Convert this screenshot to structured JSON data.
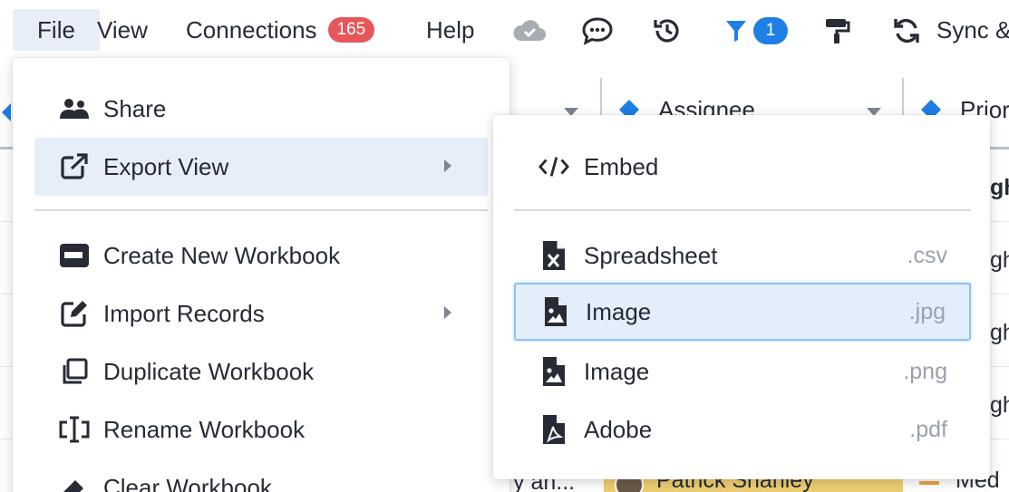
{
  "menubar": {
    "file": "File",
    "view": "View",
    "connections": "Connections",
    "connections_count": "165",
    "help": "Help",
    "filter_count": "1",
    "sync": "Sync &"
  },
  "grid": {
    "col_assignee": "Assignee",
    "col_priority": "Priori",
    "cell_truncated": "y an...",
    "cell_assignee": "Patrick Shanley",
    "cell_priority": "Med",
    "right_cells": [
      "gh",
      "gh",
      "gh",
      "gh",
      "gh"
    ]
  },
  "file_menu": {
    "items": [
      {
        "label": "Share",
        "icon": "users-icon"
      },
      {
        "label": "Export View",
        "icon": "external-link-icon"
      },
      {
        "label": "Create New Workbook",
        "icon": "id-card-icon"
      },
      {
        "label": "Import Records",
        "icon": "edit-icon"
      },
      {
        "label": "Duplicate Workbook",
        "icon": "copy-icon"
      },
      {
        "label": "Rename Workbook",
        "icon": "text-cursor-icon"
      },
      {
        "label": "Clear Workbook",
        "icon": "eraser-icon"
      }
    ]
  },
  "export_menu": {
    "items": [
      {
        "label": "Embed",
        "ext": "",
        "icon": "code-icon"
      },
      {
        "label": "Spreadsheet",
        "ext": ".csv",
        "icon": "file-excel-icon"
      },
      {
        "label": "Image",
        "ext": ".jpg",
        "icon": "file-image-icon"
      },
      {
        "label": "Image",
        "ext": ".png",
        "icon": "file-image-icon"
      },
      {
        "label": "Adobe",
        "ext": ".pdf",
        "icon": "file-pdf-icon"
      }
    ]
  },
  "colors": {
    "accent_blue": "#1e7fe5",
    "badge_red": "#e5575a",
    "menu_active_bg": "#e6eef9",
    "text_dark": "#262b36"
  }
}
